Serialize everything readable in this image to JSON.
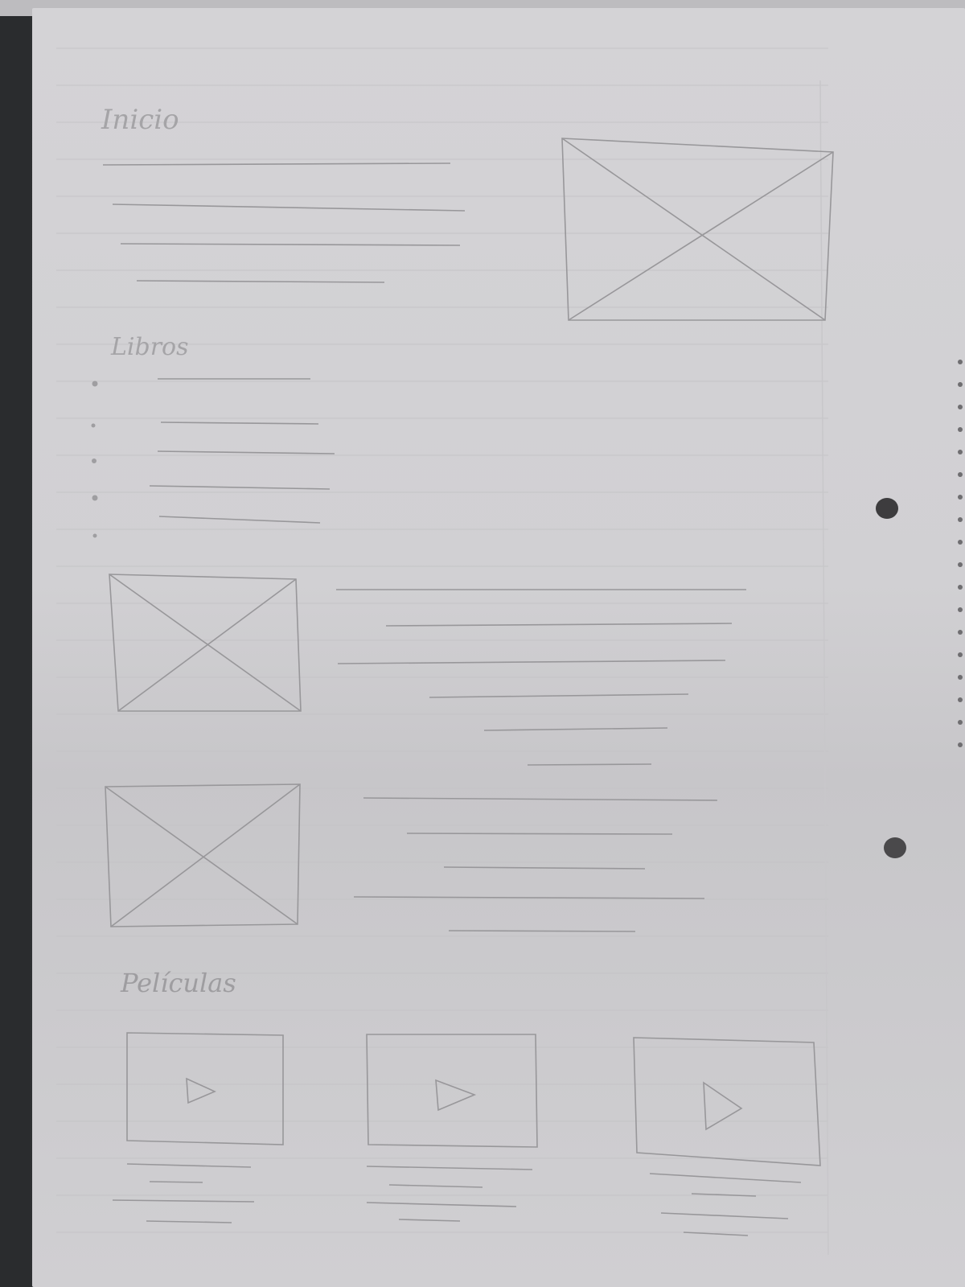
{
  "sketch": {
    "sections": [
      {
        "id": "inicio",
        "heading": "Inicio"
      },
      {
        "id": "libros",
        "heading": "Libros"
      },
      {
        "id": "peliculas",
        "heading": "Películas"
      }
    ]
  },
  "colors": {
    "paper": "#d3d2d5",
    "pencil": "#8f8e91",
    "ruled_line": "#c2c1c4",
    "background_dark": "#2a2c2e"
  },
  "icons": [
    "image-placeholder-icon",
    "play-icon"
  ]
}
